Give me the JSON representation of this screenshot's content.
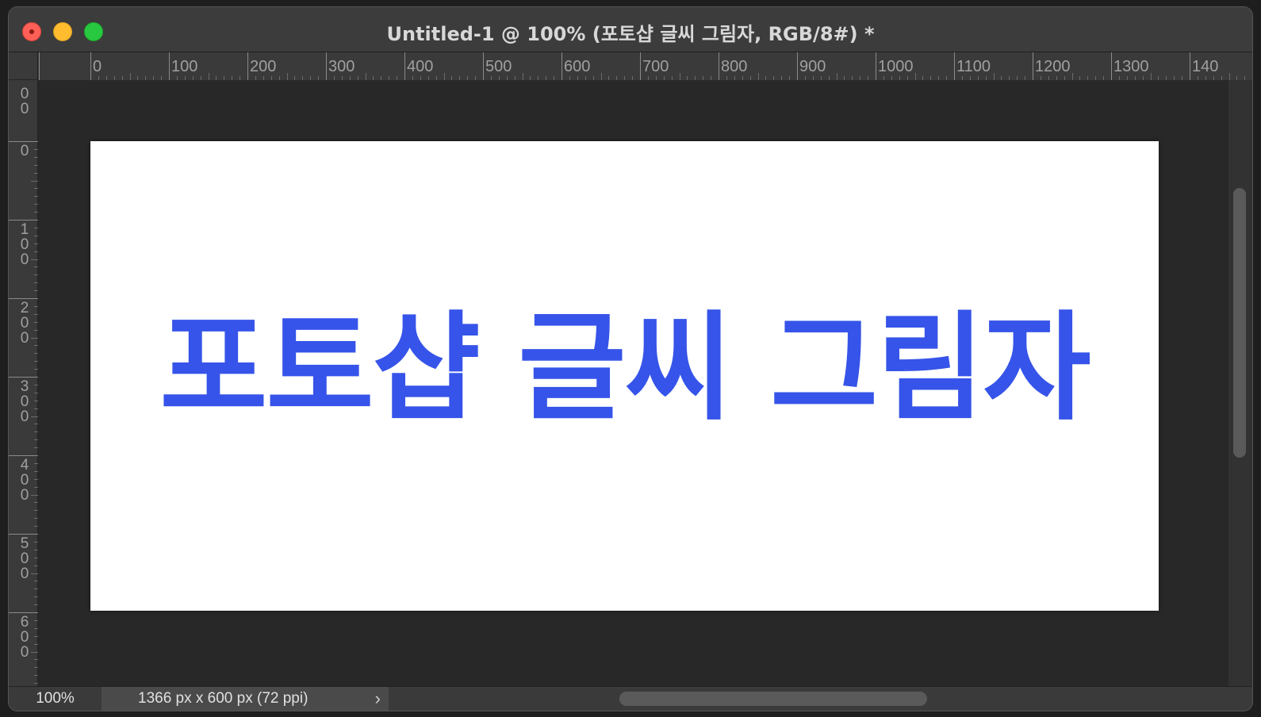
{
  "window": {
    "title": "Untitled-1 @ 100% (포토샵 글씨 그림자, RGB/8#) *"
  },
  "ruler": {
    "top_labels": [
      "0",
      "100",
      "200",
      "300",
      "400",
      "500",
      "600",
      "700",
      "800",
      "900",
      "1000",
      "1100",
      "1200",
      "1300",
      "140"
    ],
    "left_labels": [
      "0",
      "100",
      "200",
      "300",
      "400",
      "500",
      "600"
    ]
  },
  "document": {
    "text": "포토샵 글씨 그림자",
    "text_color": "#3654e9",
    "background_color": "#ffffff"
  },
  "status": {
    "zoom": "100%",
    "doc_info": "1366 px x 600 px (72 ppi)",
    "chevron": "›"
  }
}
